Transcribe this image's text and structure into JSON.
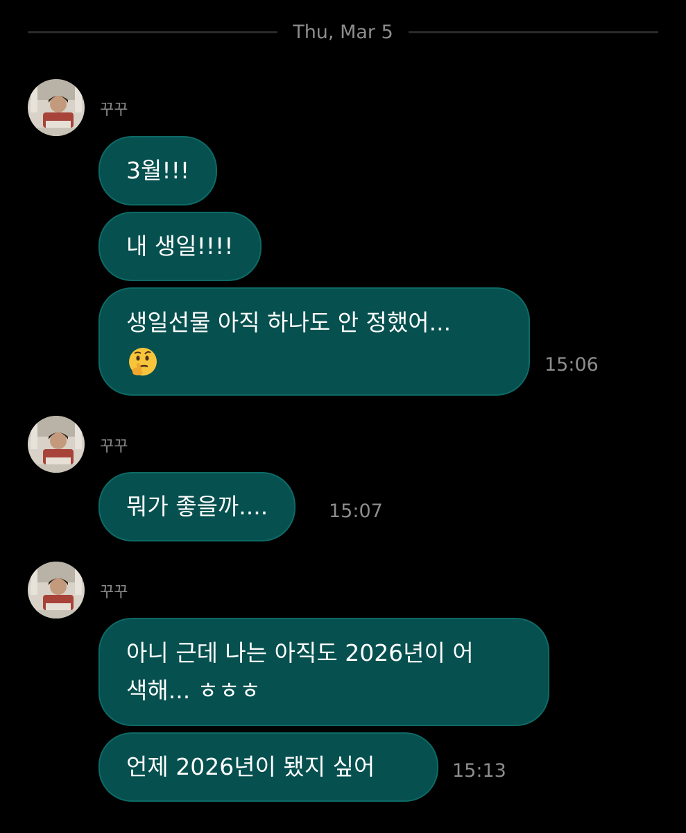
{
  "divider": {
    "date": "Thu, Mar 5"
  },
  "groups": [
    {
      "sender": "꾸꾸",
      "messages": [
        {
          "text": "3월!!!"
        },
        {
          "text": "내 생일!!!!"
        },
        {
          "lines": [
            "생일선물 아직 하나도 안 정했어..."
          ],
          "emoji": "thinking-face",
          "time": "15:06"
        }
      ]
    },
    {
      "sender": "꾸꾸",
      "messages": [
        {
          "text": "뭐가 좋을까....",
          "time": "15:07"
        }
      ]
    },
    {
      "sender": "꾸꾸",
      "messages": [
        {
          "lines": [
            "아니 근데 나는 아직도 2026년이 어",
            "색해... ㅎㅎㅎ"
          ]
        },
        {
          "text": "언제 2026년이 됐지 싶어",
          "time": "15:13"
        }
      ]
    }
  ],
  "colors": {
    "background": "#000000",
    "bubble": "#06504f",
    "bubble_border": "#0d6a66",
    "muted_text": "#8d8d8d"
  }
}
